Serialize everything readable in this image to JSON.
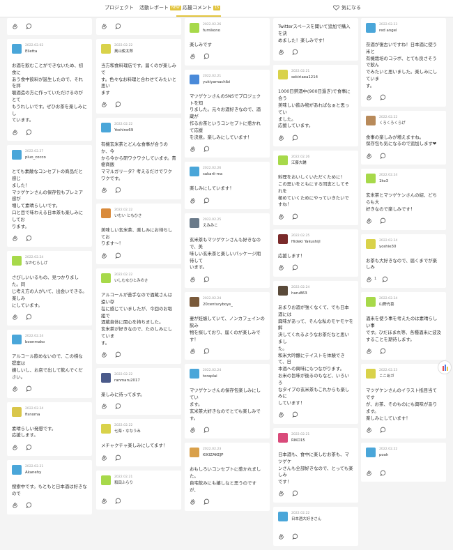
{
  "tabs": [
    {
      "label": "プロジェクト",
      "badge": ""
    },
    {
      "label": "活動レポート",
      "badge": "NEW",
      "badge_color": "#e2c43d"
    },
    {
      "label": "応援コメント",
      "badge": "15",
      "badge_color": "#e2c43d"
    }
  ],
  "favorite": {
    "label": "気になる"
  },
  "colors": {
    "accent": "#e2c43d",
    "icon": "#555555"
  },
  "columns": [
    {
      "top_actions": true,
      "cards": [
        {
          "date": "2022.02.02",
          "name": "Elletta",
          "avatar_color": "#4aa6d9",
          "body": "お酒を飲むことができないため、初食に\nあう食中飲料が誕生したので、それを拝\n聴酒造の方に作っていただけるのがとて\nもうれしいです。ぜひお茶を楽しみにし\nています。"
        },
        {
          "date": "2022.02.27",
          "name": "pluo_cocco",
          "avatar_color": "#4aa6d9",
          "body": "とても素敵なコンセプトの商品だと感じ\nました！\nマツゲケンさんの保存包もプレミア感が\n増して素晴らしいです。\n口と目で味わえる日本茶も楽しみにしてお\nります。"
        },
        {
          "date": "2022.02.24",
          "name": "なかむらしげ",
          "avatar_color": "#a7d94a",
          "body": "さびしいいるもの、見つかりました。同\nじ考え方の人がいて、出会いできる。楽しみ\nにしています。"
        },
        {
          "date": "2022.02.24",
          "name": "boonmako",
          "avatar_color": "#4aa6d9",
          "body": "アルコール飲めないので、この梯な提案は\n嬉しいし、お店で出して飲んでください。"
        },
        {
          "date": "2022.02.24",
          "name": "fisnoma",
          "avatar_color": "#d9c64a",
          "body": "素晴らしい発想です。\n応援します。"
        },
        {
          "date": "2022.02.21",
          "name": "Akanehy",
          "avatar_color": "#4aa6d9",
          "body": "搜索中です。もともと日本酒は好きなので"
        }
      ]
    },
    {
      "top_actions": true,
      "cards": [
        {
          "date": "2022.02.22",
          "name": "奥山俊太郎",
          "avatar_color": "#d9d24a",
          "body": "当方和食料理店です。届くのが楽しみで\nす。色々なお料理と合わせてみたいと思い\nます"
        },
        {
          "date": "2022.02.22",
          "name": "Yoshino69",
          "avatar_color": "#4aa6d9",
          "body": "有機玄米茶とどんな食事が合うのか、今\nから今から研ワクワクしています。青樹商飯\nママルガリータ？考えるだけでワクワクです。"
        },
        {
          "date": "2022.02.22",
          "name": "いむい ともひさ",
          "avatar_color": "#d98a3a",
          "body": "美味しい玄米茶、楽しみにお待ちしてお\nります〜！"
        },
        {
          "date": "2022.02.22",
          "name": "いしむなひとみのさ",
          "avatar_color": "#a7d94a",
          "body": "アルコールが苦手なので酒蔵さんは遠い存\n在に感じていましたが、今回のお取組で\n酒蔵自体に関心を持ちました。\n玄米茶が好きなので、たのしみにしていま\nす。"
        },
        {
          "date": "2022.02.22",
          "name": "ranmaru2017",
          "avatar_color": "#4a5a8a",
          "body": "楽しみに待ってます。"
        },
        {
          "date": "2022.02.22",
          "name": "七海・ななうみ",
          "avatar_color": "#d9d24a",
          "body": "メチャクチャ楽しみにしてます！"
        },
        {
          "date": "2022.02.21",
          "name": "和田ふらり",
          "avatar_color": "#a7d94a",
          "body": ""
        }
      ]
    },
    {
      "top_actions": false,
      "cards": [
        {
          "date": "2022.02.26",
          "name": "fumikono",
          "avatar_color": "#a7d94a",
          "body": "楽しみです"
        },
        {
          "date": "2022.02.21",
          "name": "yukiyamachibi",
          "avatar_color": "#4a8ad9",
          "body": "マツゲケンさんのSNSでプロジェクトを知\nりました。元々お酒好きなので、酒蔵が\n作るお茶というコンセプトに惹かれて応援\nを決意。楽しみにしています！"
        },
        {
          "date": "2022.02.26",
          "name": "sakarii-ma",
          "avatar_color": "#4aa6d9",
          "body": "楽しみにしています！"
        },
        {
          "date": "2022.02.25",
          "name": "えみみこ",
          "avatar_color": "#6a7a8a",
          "body": "玄米茶もマツゲケンさんも好きなので、美\n味しい玄米茶と楽しいパッケージ期待して\nいます。"
        },
        {
          "date": "2022.02.24",
          "name": "20centuryboys_",
          "avatar_color": "#7a5a3a",
          "body": "妻が妊娠していて、ノンカフェインの飲み\n物を探しており、届くのが楽しみです！"
        },
        {
          "date": "2022.02.24",
          "name": "toraplai",
          "avatar_color": "#4aa6d9",
          "body": "マツゲケンさんの保存包楽しみにしてい\nます。\n玄米茶大好きなのでとても楽しみです。"
        },
        {
          "date": "2022.02.23",
          "name": "KIKIZAKEJP",
          "avatar_color": "#d9a04a",
          "body": "おもしろいコンセプトに惹かれました。\n自宅飲みにも嬉しなと思うのですが、"
        }
      ]
    },
    {
      "top_actions": false,
      "cards": [
        {
          "date": "",
          "name": "",
          "avatar_color": "",
          "body": "Twitterスペースを聞いて追加で購入を決\nめました！楽しみです！"
        },
        {
          "date": "2022.02.21",
          "name": "sekiriaea1214",
          "avatar_color": "#d9d24a",
          "body": "1000日禁酒中(900日過ぎ)で食事に合う\n美味しい飲み物があればなぁと思ってい\nました。\n応援しています。"
        },
        {
          "date": "2022.02.26",
          "name": "江藤大輔",
          "avatar_color": "#a7d94a",
          "body": "料理をおいしくいただくために！\nこの思いをともにする同志としてそれを\n極めていくためにやっていきたいですね！"
        },
        {
          "date": "2022.02.25",
          "name": "Hideki YakushijI",
          "avatar_color": "#7a2a2a",
          "body": "応援します！"
        },
        {
          "date": "2022.02.24",
          "name": "haru863",
          "avatar_color": "#5a4a3a",
          "body": "あまりお酒が強くなくて、でも日本酒には\n興味があって、そんな私のモヤモヤを解\n決してくれるようなお茶だなと思いまし\nた。\n和米大吟醸にテイストを体験できて、日\n本酒への興味にもつながります。\nお米の旨味が後るのもなど、いろいろ\nなタイプの玄米茶もこれからも楽しみに\nしています！"
        },
        {
          "date": "2022.02.21",
          "name": "RIKO15",
          "avatar_color": "#d94a7a",
          "body": "日本酒も、食中に楽しむお茶も、マツゲケ\nンさんも全部好きなので、とっても楽しみ\nです！"
        },
        {
          "date": "2022.02.22",
          "name": "日本酒大好きさん",
          "avatar_color": "#4aa6d9",
          "body": ""
        }
      ]
    },
    {
      "top_actions": false,
      "cards": [
        {
          "date": "2022.02.23",
          "name": "red angel",
          "avatar_color": "#4aa6d9",
          "body": "奈酒が復古いですね！日本酒に使う米と\n有機栽培のコラボ、とても良さそうで飲ん\nでみたいと思いました。楽しみにしていま\nす。"
        },
        {
          "date": "2022.02.22",
          "name": "くろくろくらげ",
          "avatar_color": "#b88a5a",
          "body": "食事の楽しみが増えますね。\n保存包も気になるので追加します❤"
        },
        {
          "date": "2022.02.24",
          "name": "1ko3",
          "avatar_color": "#a7d94a",
          "body": "玄米茶とマツゲケンさんの紹、どちらも大\n好きなので楽しみです！"
        },
        {
          "date": "2022.02.24",
          "name": "yoshie30",
          "avatar_color": "#d9d24a",
          "body": "お茶も大好きなので、届くまでが楽しみ"
        },
        {
          "date": "2022.02.24",
          "name": "山野光喜",
          "avatar_color": "#a7d94a",
          "body": "酒米を使う事を考えたのは素晴らしい事\nです。ひだほまれ等、各種酒米に波及\nすることを期待します。"
        },
        {
          "date": "2022.02.23",
          "name": "ここあガ",
          "avatar_color": "#d9d24a",
          "body": "マツゲケンさんのイラスト抵目当てです\nが、お茶、そのものにも興味があります。\n楽しみにしています！"
        },
        {
          "date": "2022.02.22",
          "name": "pooh",
          "avatar_color": "#4aa6d9",
          "body": ""
        }
      ]
    }
  ],
  "reaction_count": "1"
}
